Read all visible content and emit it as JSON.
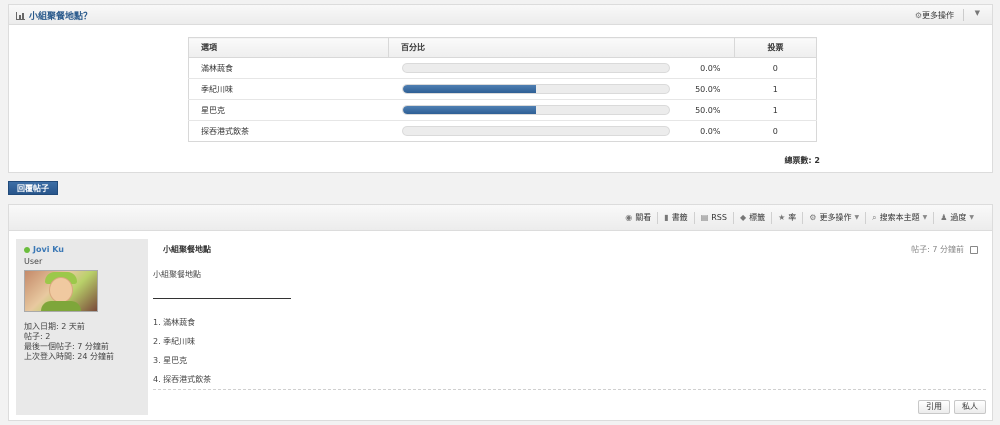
{
  "poll": {
    "title": "小組聚餐地點？",
    "more_actions": "更多操作",
    "headers": {
      "option": "選項",
      "percent": "百分比",
      "votes": "投票"
    },
    "options": [
      {
        "label": "滿林蔬食",
        "percent": 0.0,
        "percent_text": "0.0%",
        "votes": "0"
      },
      {
        "label": "季紀川味",
        "percent": 50.0,
        "percent_text": "50.0%",
        "votes": "1"
      },
      {
        "label": "星巴克",
        "percent": 50.0,
        "percent_text": "50.0%",
        "votes": "1"
      },
      {
        "label": "探吞港式飲茶",
        "percent": 0.0,
        "percent_text": "0.0%",
        "votes": "0"
      }
    ],
    "total": "總票數: 2"
  },
  "reply_button": "回覆帖子",
  "toolbar": {
    "items": [
      {
        "label": "關看",
        "icon": "eye-icon",
        "glyph": "◉"
      },
      {
        "label": "書籤",
        "icon": "bookmark-icon",
        "glyph": "▮"
      },
      {
        "label": "RSS",
        "icon": "rss-icon",
        "glyph": "▤"
      },
      {
        "label": "標籤",
        "icon": "tag-icon",
        "glyph": "◆"
      },
      {
        "label": "率",
        "icon": "star-icon",
        "glyph": "★"
      },
      {
        "label": "更多操作",
        "icon": "gear-icon",
        "glyph": "⚙"
      },
      {
        "label": "搜索本主題",
        "icon": "search-icon",
        "glyph": "⌕"
      },
      {
        "label": "過度",
        "icon": "user-icon",
        "glyph": "♟"
      }
    ]
  },
  "author": {
    "name": "Jovi Ku",
    "role": "User",
    "stats": [
      "加入日期: 2 天前",
      "帖子: 2",
      "最後一個帖子: 7 分鐘前",
      "上次登入時間: 24 分鐘前"
    ]
  },
  "post": {
    "title": "小組聚餐地點",
    "meta": "帖子: 7 分鐘前",
    "intro": "小組聚餐地點",
    "items": [
      "1. 滿林蔬食",
      "2. 季紀川味",
      "3. 星巴克",
      "4. 探吞港式飲茶"
    ],
    "quote_button": "引用",
    "private_button": "私人"
  },
  "colors": {
    "accent": "#2e5f95",
    "online": "#6bbd3d",
    "author_link": "#3b78b5"
  }
}
